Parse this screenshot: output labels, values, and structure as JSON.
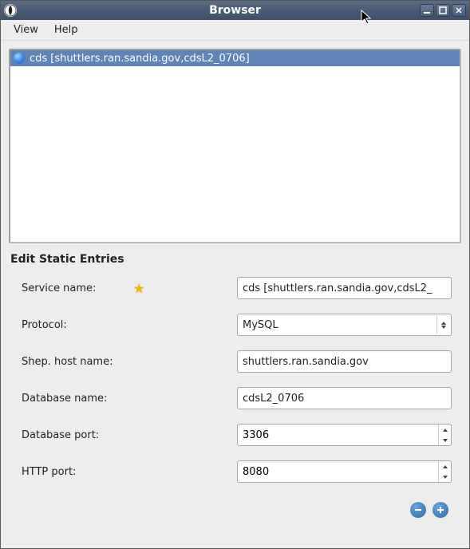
{
  "window": {
    "title": "Browser"
  },
  "menu": {
    "view": "View",
    "help": "Help"
  },
  "list": {
    "items": [
      {
        "label": "cds [shuttlers.ran.sandia.gov,cdsL2_0706]",
        "selected": true
      }
    ]
  },
  "section": {
    "title": "Edit Static Entries"
  },
  "form": {
    "service_name": {
      "label": "Service name:",
      "value": "cds [shuttlers.ran.sandia.gov,cdsL2_"
    },
    "protocol": {
      "label": "Protocol:",
      "value": "MySQL"
    },
    "shep_host": {
      "label": "Shep. host name:",
      "value": "shuttlers.ran.sandia.gov"
    },
    "db_name": {
      "label": "Database name:",
      "value": "cdsL2_0706"
    },
    "db_port": {
      "label": "Database port:",
      "value": "3306"
    },
    "http_port": {
      "label": "HTTP port:",
      "value": "8080"
    }
  }
}
